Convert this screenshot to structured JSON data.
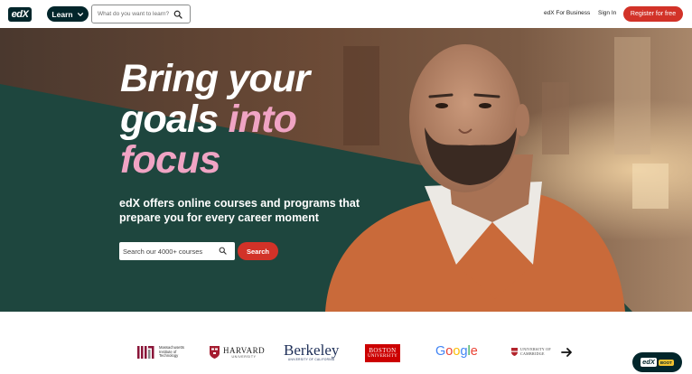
{
  "header": {
    "logo_text": "edX",
    "learn_label": "Learn",
    "search_placeholder": "What do you want to learn?",
    "business_link": "edX For Business",
    "signin_link": "Sign In",
    "register_label": "Register for free"
  },
  "hero": {
    "headline_line1": "Bring your",
    "headline_line2_white": "goals ",
    "headline_line2_pink": "into",
    "headline_line3_pink": "focus",
    "subhead": "edX offers online courses and programs that prepare you for every career moment",
    "search_placeholder": "Search our 4000+ courses",
    "search_button": "Search"
  },
  "partners": {
    "mit_text": "Massachusetts Institute of Technology",
    "harvard_name": "HARVARD",
    "harvard_sub": "UNIVERSITY",
    "berkeley_name": "Berkeley",
    "berkeley_sub": "UNIVERSITY OF CALIFORNIA",
    "bu_name": "BOSTON",
    "bu_sub": "UNIVERSITY",
    "google": [
      "G",
      "o",
      "o",
      "g",
      "l",
      "e"
    ],
    "cambridge_line1": "UNIVERSITY OF",
    "cambridge_line2": "CAMBRIDGE"
  },
  "chat_badge": {
    "logo_text": "edX",
    "tag_text": "BOOT"
  },
  "colors": {
    "brand_dark": "#02262b",
    "accent_red": "#d23228",
    "headline_pink": "#f0a4c4",
    "hero_green": "#1e463e",
    "sweater_orange": "#c96a3a"
  },
  "icons": {
    "learn_chevron": "chevron-down-icon",
    "search": "search-icon",
    "next": "arrow-right-icon"
  }
}
